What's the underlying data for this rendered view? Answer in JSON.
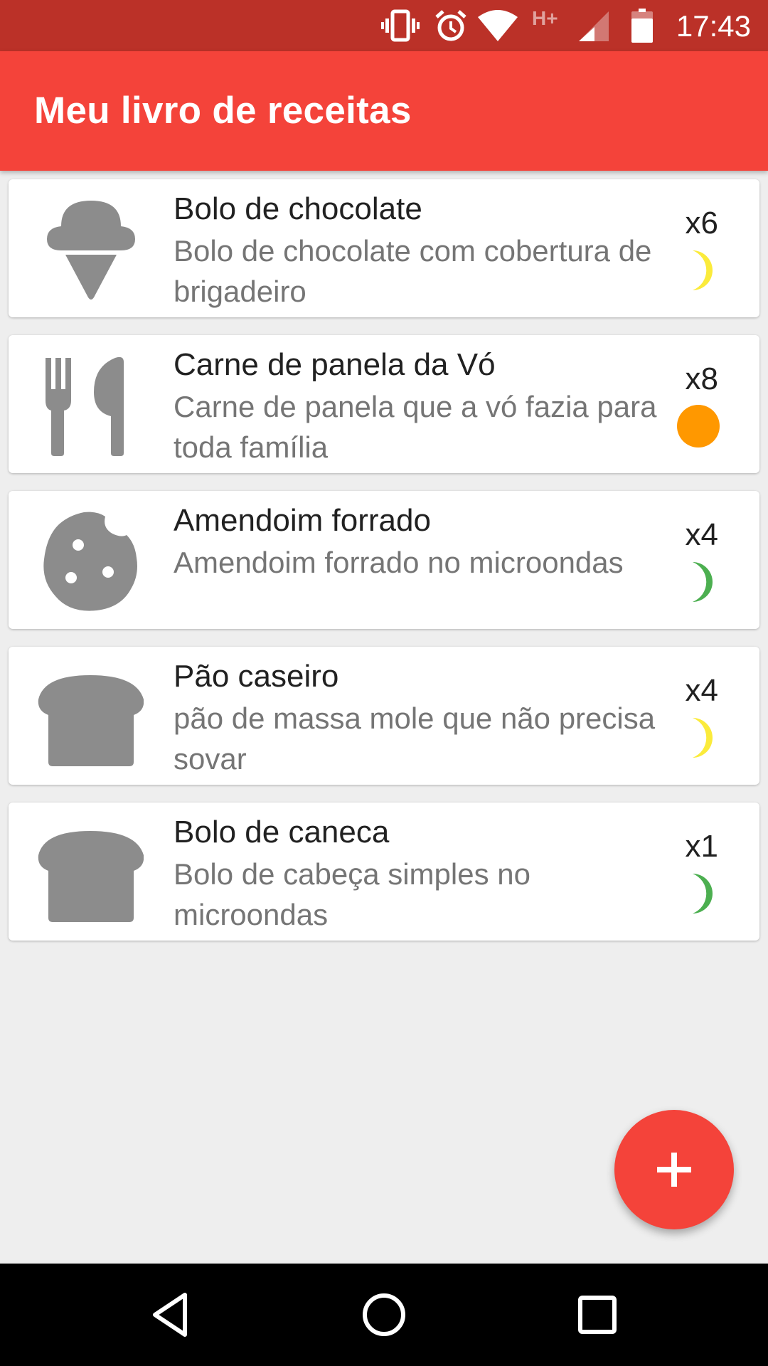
{
  "status_bar": {
    "time": "17:43",
    "network_label": "H+",
    "icons": [
      "vibrate-icon",
      "alarm-icon",
      "wifi-icon",
      "signal-icon",
      "battery-icon"
    ]
  },
  "app_bar": {
    "title": "Meu livro de receitas",
    "color": "#f4433a"
  },
  "recipes": [
    {
      "name": "Bolo de chocolate",
      "description": "Bolo de chocolate com cobertura de brigadeiro",
      "quantity": "x6",
      "icon": "ice-cream-icon",
      "indicator": "moon-yellow",
      "indicator_color": "#fbeb3b"
    },
    {
      "name": "Carne de panela da Vó",
      "description": "Carne de panela que a vó fazia para toda família",
      "quantity": "x8",
      "icon": "utensils-icon",
      "indicator": "circle-orange",
      "indicator_color": "#ff9800"
    },
    {
      "name": "Amendoim forrado",
      "description": "Amendoim forrado no microondas",
      "quantity": "x4",
      "icon": "cookie-icon",
      "indicator": "moon-green",
      "indicator_color": "#4caf50"
    },
    {
      "name": "Pão caseiro",
      "description": "pão de massa mole que não precisa sovar",
      "quantity": "x4",
      "icon": "bread-icon",
      "indicator": "moon-yellow",
      "indicator_color": "#fbeb3b"
    },
    {
      "name": "Bolo de caneca",
      "description": "Bolo de cabeça simples no microondas",
      "quantity": "x1",
      "icon": "bread-icon",
      "indicator": "moon-green",
      "indicator_color": "#4caf50"
    }
  ],
  "fab": {
    "icon": "plus-icon",
    "color": "#f4433a"
  },
  "nav_bar": {
    "icons": [
      "back-icon",
      "home-icon",
      "recents-icon"
    ]
  }
}
